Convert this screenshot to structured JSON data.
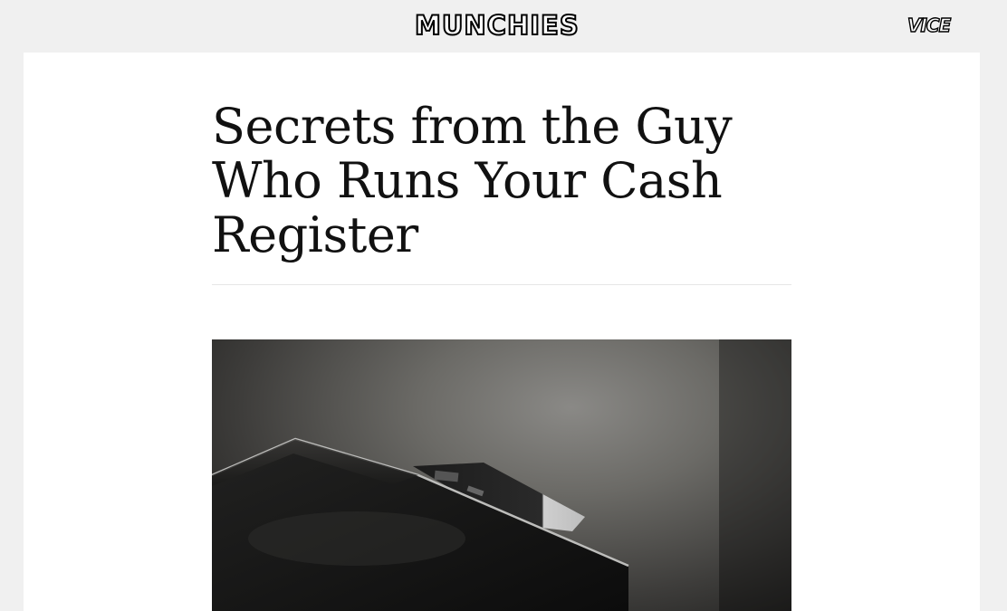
{
  "header": {
    "brand": "MUNCHIES",
    "network_brand": "VICE"
  },
  "article": {
    "headline": "Secrets from the Guy Who Runs Your Cash Register",
    "hero_image": {
      "icon": "wallet-with-credit-card-photo"
    }
  },
  "colors": {
    "page_background": "#f0f0f0",
    "content_background": "#ffffff",
    "text": "#111111",
    "divider": "#e6e6e6"
  }
}
